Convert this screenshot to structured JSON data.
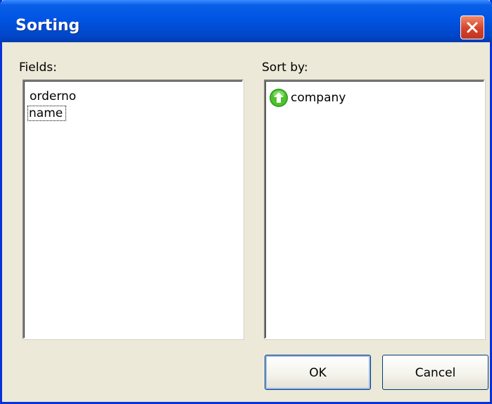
{
  "window": {
    "title": "Sorting"
  },
  "fields": {
    "label": "Fields:",
    "items": [
      "orderno",
      "name"
    ]
  },
  "sort_by": {
    "label": "Sort by:",
    "items": [
      {
        "name": "company",
        "direction": "ascending",
        "icon": "arrow-up-circle-icon"
      }
    ]
  },
  "buttons": {
    "ok": "OK",
    "cancel": "Cancel"
  },
  "colors": {
    "titlebar": "#0054e3",
    "close": "#d6422a",
    "dialog_bg": "#ece9d8",
    "sort_icon": "#2e9a1a"
  }
}
